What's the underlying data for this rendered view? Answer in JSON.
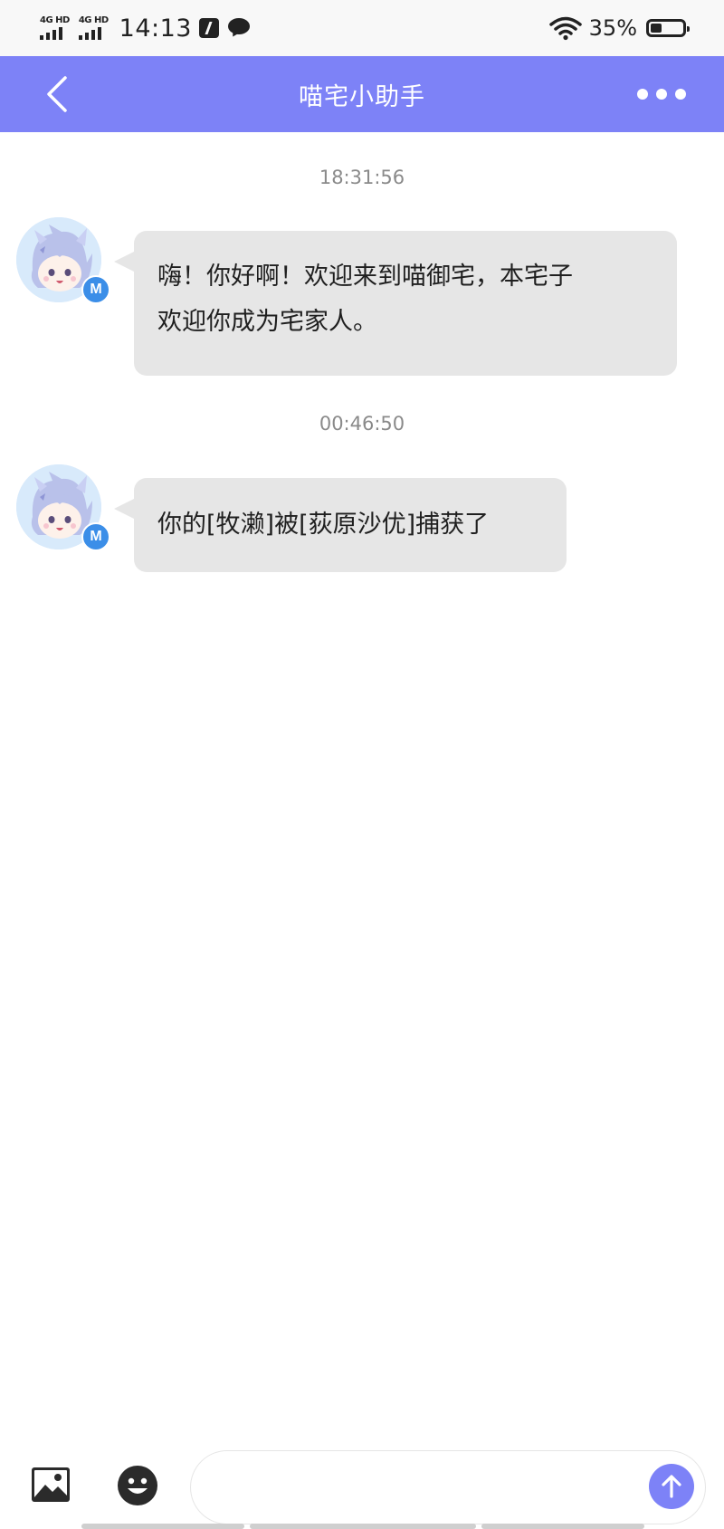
{
  "status_bar": {
    "network1": "4G HD",
    "network2": "4G HD",
    "time": "14:13",
    "battery": "35%"
  },
  "header": {
    "title": "喵宅小助手",
    "back_icon": "chevron-left-icon",
    "more_icon": "more-dots-icon",
    "color": "#7d82f7"
  },
  "messages": [
    {
      "timestamp": "18:31:56",
      "sender": "喵宅小助手",
      "badge": "M",
      "lines": [
        "嗨！你好啊！欢迎来到喵御宅，本宅子",
        "欢迎你成为宅家人。"
      ]
    },
    {
      "timestamp": "00:46:50",
      "sender": "喵宅小助手",
      "badge": "M",
      "lines": [
        "你的[牧濑]被[荻原沙优]捕获了"
      ]
    }
  ],
  "input_bar": {
    "image_icon": "image-icon",
    "emoji_icon": "emoji-icon",
    "input_value": "",
    "send_icon": "arrow-up-icon"
  }
}
